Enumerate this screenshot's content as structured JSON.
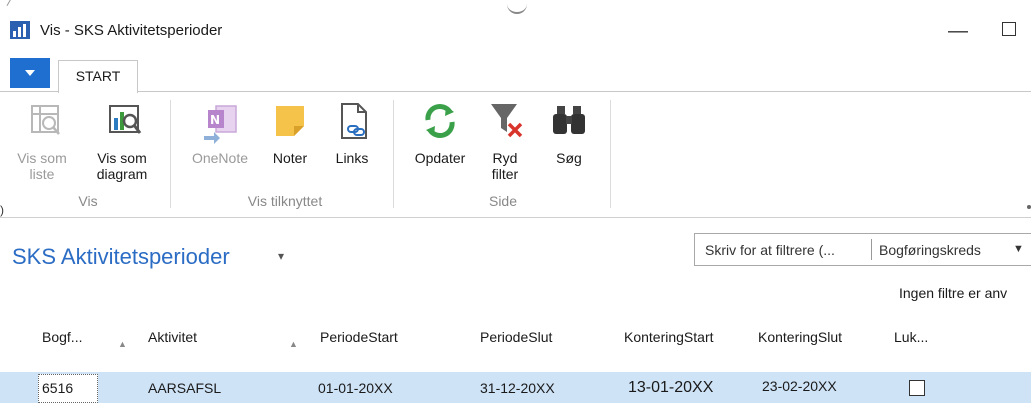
{
  "window": {
    "title": "Vis - SKS Aktivitetsperioder",
    "minimize_glyph": "—",
    "app_icon": "chart-icon"
  },
  "tabs": {
    "file_glyph": "▼",
    "start_label": "START"
  },
  "ribbon": {
    "groups": [
      {
        "label": "Vis",
        "buttons": [
          {
            "label1": "Vis som",
            "label2": "liste",
            "icon": "list-view-icon",
            "enabled": false
          },
          {
            "label1": "Vis som",
            "label2": "diagram",
            "icon": "chart-view-icon",
            "enabled": true
          }
        ]
      },
      {
        "label": "Vis tilknyttet",
        "buttons": [
          {
            "label1": "OneNote",
            "label2": "",
            "icon": "onenote-icon",
            "enabled": false
          },
          {
            "label1": "Noter",
            "label2": "",
            "icon": "note-icon",
            "enabled": true
          },
          {
            "label1": "Links",
            "label2": "",
            "icon": "link-icon",
            "enabled": true
          }
        ]
      },
      {
        "label": "Side",
        "buttons": [
          {
            "label1": "Opdater",
            "label2": "",
            "icon": "refresh-icon",
            "enabled": true
          },
          {
            "label1": "Ryd",
            "label2": "filter",
            "icon": "clear-filter-icon",
            "enabled": true
          },
          {
            "label1": "Søg",
            "label2": "",
            "icon": "binoculars-icon",
            "enabled": true
          }
        ]
      }
    ]
  },
  "page": {
    "title": "SKS Aktivitetsperioder",
    "title_caret": "▾"
  },
  "filter": {
    "placeholder": "Skriv for at filtrere (...",
    "field": "Bogføringskreds",
    "caret": "▼",
    "status": "Ingen filtre er anv"
  },
  "grid": {
    "columns": [
      "Bogf...",
      "Aktivitet",
      "PeriodeStart",
      "PeriodeSlut",
      "KonteringStart",
      "KonteringSlut",
      "Luk..."
    ],
    "sort_glyph": "▲",
    "rows": [
      {
        "bogf": "6516",
        "aktivitet": "AARSAFSL",
        "periode_start": "01-01-20XX",
        "periode_slut": "31-12-20XX",
        "kontering_start": "13-01-20XX",
        "kontering_slut": "23-02-20XX",
        "luk": false
      }
    ]
  },
  "colors": {
    "accent": "#2b6cc4",
    "file_tab": "#1e6fd0",
    "selected_row": "#cfe3f7"
  }
}
